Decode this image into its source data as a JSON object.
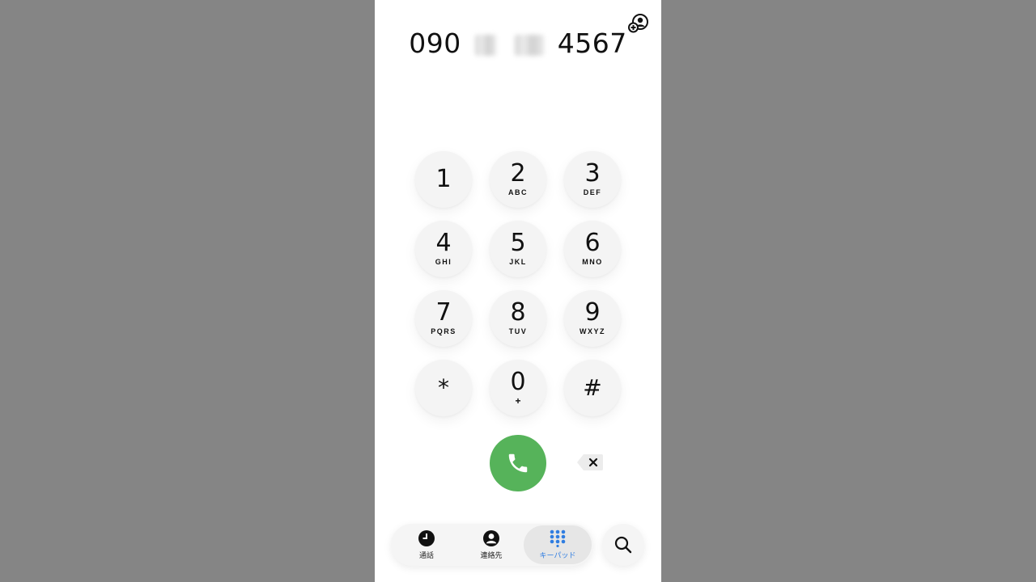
{
  "dialer": {
    "number_prefix": "090",
    "number_suffix": "4567"
  },
  "keypad": {
    "keys": [
      {
        "digit": "1",
        "letters": ""
      },
      {
        "digit": "2",
        "letters": "ABC"
      },
      {
        "digit": "3",
        "letters": "DEF"
      },
      {
        "digit": "4",
        "letters": "GHI"
      },
      {
        "digit": "5",
        "letters": "JKL"
      },
      {
        "digit": "6",
        "letters": "MNO"
      },
      {
        "digit": "7",
        "letters": "PQRS"
      },
      {
        "digit": "8",
        "letters": "TUV"
      },
      {
        "digit": "9",
        "letters": "WXYZ"
      },
      {
        "digit": "*",
        "letters": ""
      },
      {
        "digit": "0",
        "letters": "+"
      },
      {
        "digit": "#",
        "letters": ""
      }
    ]
  },
  "tabs": [
    {
      "label": "通話",
      "icon": "clock-icon",
      "active": false
    },
    {
      "label": "連絡先",
      "icon": "person-icon",
      "active": false
    },
    {
      "label": "キーパッド",
      "icon": "keypad-grid-icon",
      "active": true
    }
  ],
  "colors": {
    "call_green": "#56b35a",
    "active_tab_blue": "#2f7de1",
    "background_gray": "#858585"
  },
  "icons": {
    "add_contact": "add-contact-icon",
    "call": "phone-icon",
    "delete": "backspace-icon",
    "search": "search-icon"
  }
}
